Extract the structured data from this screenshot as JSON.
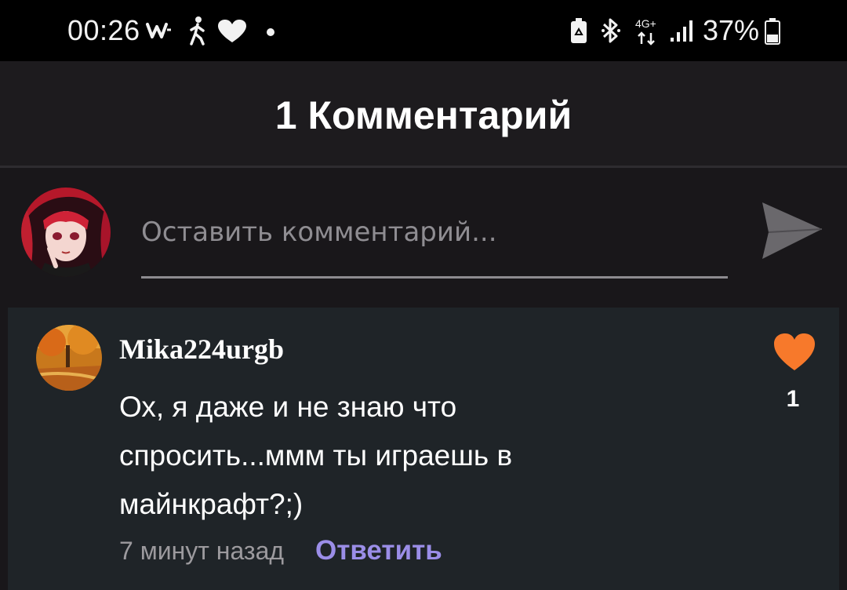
{
  "status_bar": {
    "time": "00:26",
    "battery_percent": "37%",
    "network_label": "4G+",
    "icons": [
      "webtoon-w-icon",
      "walking-icon",
      "heart-icon",
      "dot-icon",
      "battery-saver-icon",
      "bluetooth-icon",
      "network-4g-icon",
      "signal-icon",
      "battery-icon"
    ]
  },
  "header": {
    "title": "1 Комментарий"
  },
  "composer": {
    "placeholder": "Оставить комментарий...",
    "value": "",
    "send_icon": "send-icon"
  },
  "comments": [
    {
      "author": "Mika224urgb",
      "text": "Ох, я даже и не знаю что спросить...ммм ты играешь в майнкрафт?;)",
      "time": "7 минут назад",
      "reply_label": "Ответить",
      "likes": "1",
      "like_icon": "heart-icon"
    }
  ],
  "colors": {
    "background": "#19171a",
    "header": "#1d1b1e",
    "comment_card": "#1f2428",
    "like_heart": "#f7792b",
    "reply_accent": "#9b8ee8"
  }
}
